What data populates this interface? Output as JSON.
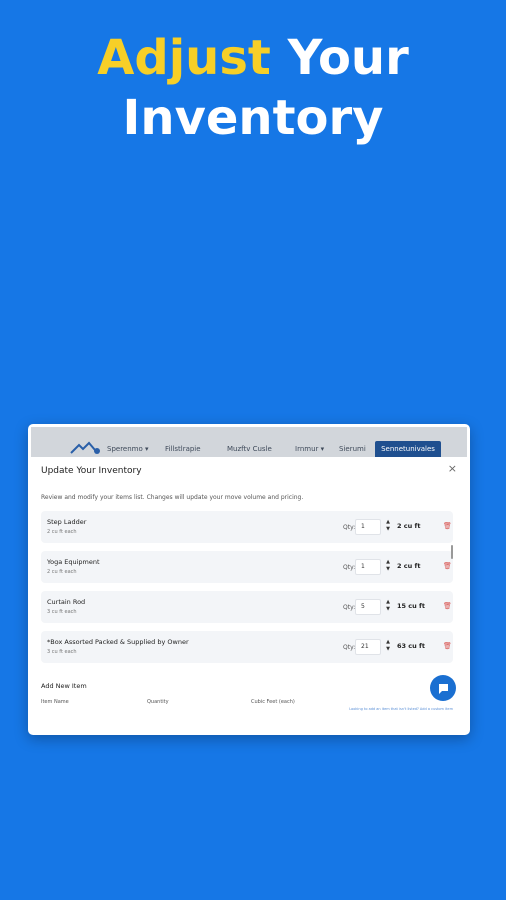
{
  "headline": {
    "accent": "Adjust",
    "line1_rest": "Your",
    "line2": "Inventory"
  },
  "colors": {
    "background": "#1677e6",
    "accent": "#f7cf27",
    "nav_active": "#1f4f8f",
    "chat": "#1a6fd1",
    "trash": "#d9534f"
  },
  "nav": {
    "items": [
      "Sperenmo ▾",
      "Fillstlrapie",
      "Muzftv Cusle",
      "Irnmur ▾",
      "Sierumi"
    ],
    "active": "Sennetunivales"
  },
  "modal": {
    "title": "Update Your Inventory",
    "close_icon": "close-icon",
    "description": "Review and modify your items list. Changes will update your move volume and pricing.",
    "qty_label": "Qty:",
    "items": [
      {
        "name": "Step Ladder",
        "sub": "2 cu ft each",
        "qty": "1",
        "volume": "2 cu ft"
      },
      {
        "name": "Yoga Equipment",
        "sub": "2 cu ft each",
        "qty": "1",
        "volume": "2 cu ft"
      },
      {
        "name": "Curtain Rod",
        "sub": "3 cu ft each",
        "qty": "5",
        "volume": "15 cu ft"
      },
      {
        "name": "*Box Assorted Packed & Supplied by Owner",
        "sub": "3 cu ft each",
        "qty": "21",
        "volume": "63 cu ft"
      }
    ],
    "add_new_title": "Add New Item",
    "columns": [
      "Item Name",
      "Quantity",
      "Cubic Feet (each)"
    ],
    "footer_link": "Looking to add an item that isn't listed? Add a custom item"
  }
}
